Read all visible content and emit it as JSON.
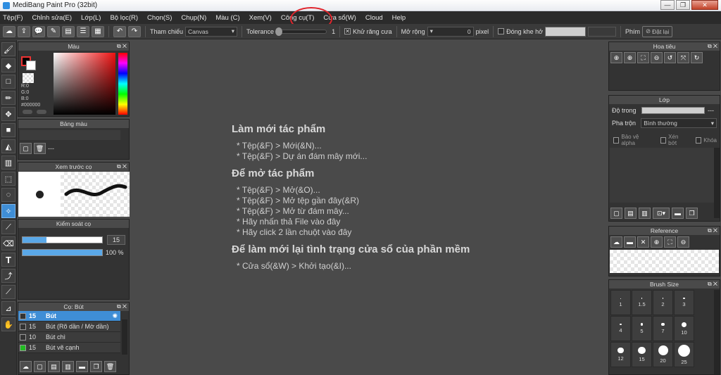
{
  "window": {
    "title": "MediBang Paint Pro (32bit)"
  },
  "menu": [
    "Tệp(F)",
    "Chỉnh sửa(E)",
    "Lớp(L)",
    "Bộ lọc(R)",
    "Chọn(S)",
    "Chụp(N)",
    "Màu (C)",
    "Xem(V)",
    "Công cụ(T)",
    "Cửa sổ(W)",
    "Cloud",
    "Help"
  ],
  "toolbar": {
    "reference_label": "Tham chiếu",
    "reference_value": "Canvas",
    "tolerance_label": "Tolerance",
    "tolerance_value": "1",
    "antialias_label": "Khử răng cưa",
    "expand_label": "Mở rộng",
    "expand_value": "0",
    "pixel_label": "pixel",
    "close_gap_label": "Đóng khe hở",
    "reset_label": "Đặt lại",
    "key_label": "Phím"
  },
  "color_panel": {
    "title": "Màu",
    "r": "R:0",
    "g": "G:0",
    "b": "B:0",
    "hex": "#000000"
  },
  "palette_panel": {
    "title": "Bảng màu",
    "value": "---"
  },
  "brush_preview_panel": {
    "title": "Xem trước cọ"
  },
  "brush_control_panel": {
    "title": "Kiểm soát cọ",
    "size": "15",
    "opacity": "100 %",
    "size_fill": 0.3,
    "opacity_fill": 1.0
  },
  "brush_list_panel": {
    "title": "Cọ: Bút",
    "items": [
      {
        "size": "15",
        "name": "Bút",
        "selected": true,
        "color": "#333333"
      },
      {
        "size": "15",
        "name": "Bút (Rõ dần / Mờ dần)",
        "selected": false,
        "color": "#333333"
      },
      {
        "size": "10",
        "name": "Bút chì",
        "selected": false,
        "color": "#333333"
      },
      {
        "size": "15",
        "name": "Bút vẽ cạnh",
        "selected": false,
        "color": "#22bb22"
      }
    ]
  },
  "welcome": {
    "new_title": "Làm mới tác phẩm",
    "new_items": [
      "* Tệp(&F) > Mới(&N)...",
      "* Tệp(&F) > Dự án đám mây mới..."
    ],
    "open_title": "Để mở tác phẩm",
    "open_items": [
      "* Tệp(&F) > Mở(&O)...",
      "* Tệp(&F) > Mở tệp gần đây(&R)",
      "* Tệp(&F) > Mở từ đám mây...",
      "* Hãy nhấn thả File vào đây",
      "* Hãy click 2 lần chuột vào đây"
    ],
    "reset_title": "Để làm mới lại tình trạng cửa sổ của phần mềm",
    "reset_items": [
      "* Cửa sổ(&W) > Khởi tạo(&I)..."
    ]
  },
  "navigator_panel": {
    "title": "Hoa tiêu"
  },
  "layer_panel": {
    "title": "Lớp",
    "opacity_label": "Độ trong",
    "opacity_value": "---",
    "blend_label": "Pha trộn",
    "blend_value": "Bình thường",
    "protect_alpha": "Bảo vệ alpha",
    "clipping": "Xén bớt",
    "lock": "Khóa"
  },
  "reference_panel": {
    "title": "Reference"
  },
  "brush_size_panel": {
    "title": "Brush Size",
    "sizes": [
      "1",
      "1.5",
      "2",
      "3",
      "4",
      "5",
      "7",
      "10",
      "12",
      "15",
      "20",
      "25"
    ]
  }
}
